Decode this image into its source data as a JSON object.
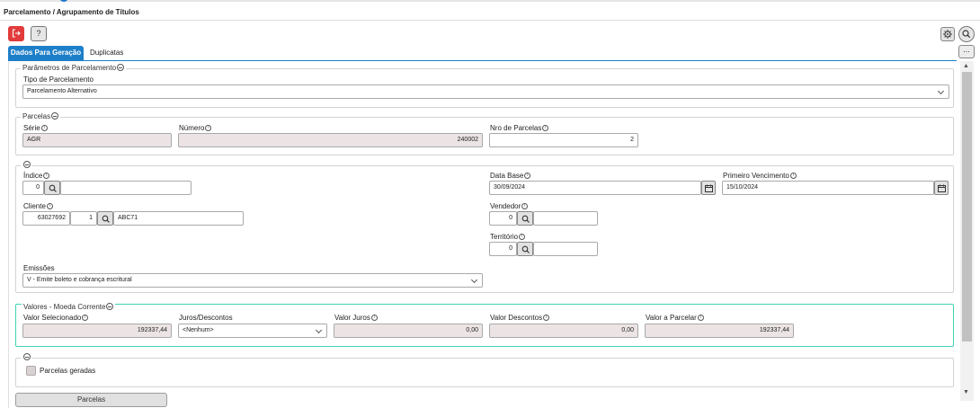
{
  "page": {
    "title": "Parcelamento / Agrupamento de Títulos"
  },
  "toolbar": {
    "help_label": "?",
    "more_label": "..."
  },
  "tabs": [
    {
      "label": "Dados Para Geração",
      "active": true
    },
    {
      "label": "Duplicatas",
      "active": false
    }
  ],
  "parametros": {
    "legend": "Parâmetros de Parcelamento",
    "tipo_label": "Tipo de Parcelamento",
    "tipo_value": "Parcelamento Alternativo"
  },
  "parcelas": {
    "legend": "Parcelas",
    "serie_label": "Série",
    "serie_value": "AGR",
    "numero_label": "Número",
    "numero_value": "240002",
    "nro_label": "Nro de Parcelas",
    "nro_value": "2"
  },
  "geral": {
    "indice_label": "Índice",
    "indice_value": "0",
    "cliente_label": "Cliente",
    "cliente_code": "63027692",
    "cliente_seq": "1",
    "cliente_name": "ABC71",
    "emissoes_label": "Emissões",
    "emissoes_value": "V - Emite boleto e cobrança escritural",
    "data_base_label": "Data Base",
    "data_base_value": "30/09/2024",
    "primeiro_venc_label": "Primeiro Vencimento",
    "primeiro_venc_value": "15/10/2024",
    "vendedor_label": "Vendedor",
    "vendedor_value": "0",
    "territorio_label": "Território",
    "territorio_value": "0"
  },
  "valores": {
    "legend": "Valores - Moeda Corrente",
    "selecionado_label": "Valor Selecionado",
    "selecionado_value": "192337,44",
    "juros_desc_label": "Juros/Descontos",
    "juros_desc_value": "<Nenhum>",
    "valor_juros_label": "Valor Juros",
    "valor_juros_value": "0,00",
    "valor_descontos_label": "Valor Descontos",
    "valor_descontos_value": "0,00",
    "valor_parcelar_label": "Valor a Parcelar",
    "valor_parcelar_value": "192337,44"
  },
  "geradas": {
    "checkbox_label": "Parcelas geradas",
    "checked": false
  },
  "footer": {
    "button_label": "Parcelas"
  },
  "colors": {
    "accent": "#1e7fc9",
    "exit": "#e23b3b",
    "highlight_border": "#3ed3b5",
    "readonly_bg": "#ece4e4"
  },
  "icons": [
    "exit-icon",
    "help-icon",
    "gear-icon",
    "search-icon",
    "more-icon",
    "info-icon",
    "collapse-icon",
    "calendar-icon",
    "chevron-down-icon"
  ]
}
